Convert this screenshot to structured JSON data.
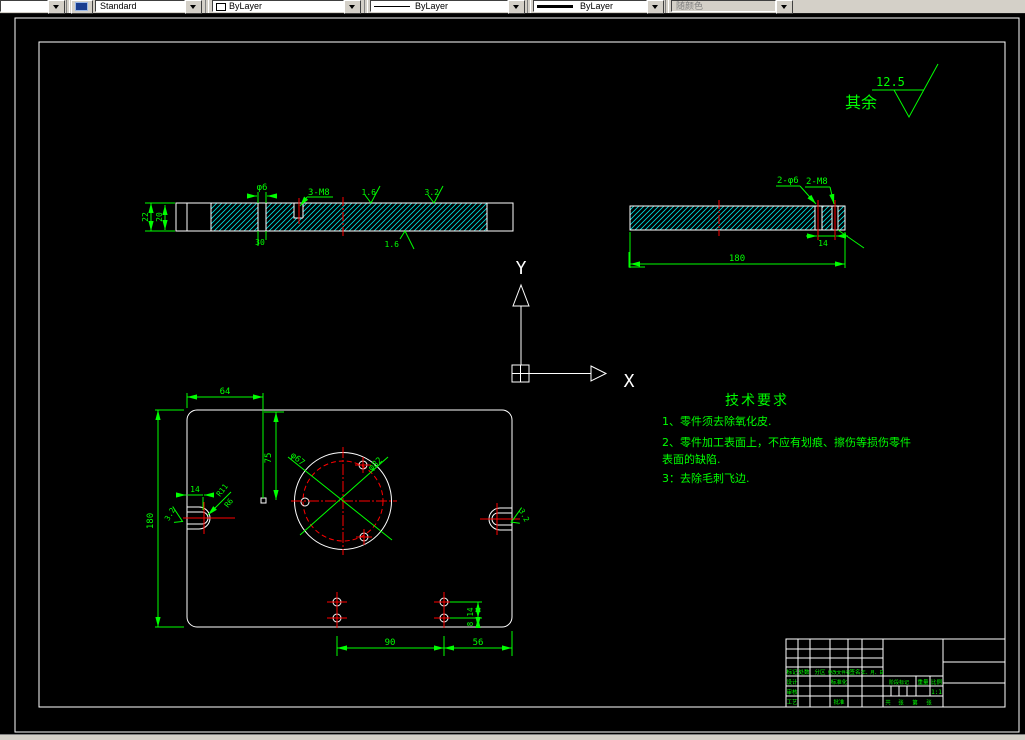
{
  "toolbar": {
    "style_combo": {
      "value": "Standard"
    },
    "color_combo": {
      "value": "ByLayer"
    },
    "linetype_combo": {
      "value": "ByLayer"
    },
    "lineweight_combo": {
      "value": "ByLayer"
    },
    "plotstyle_combo": {
      "value": "随颜色"
    }
  },
  "surface_note": {
    "prefix": "其余",
    "value": "12.5"
  },
  "ucs": {
    "x_label": "X",
    "y_label": "Y"
  },
  "section_left": {
    "dim_height_outer": "22",
    "dim_height_inner": "20",
    "hole_dia": "φ6",
    "hole_note": "30",
    "thread_label": "3-M8",
    "rough_top_1": "1.6",
    "rough_top_2": "3.2",
    "rough_bottom": "1.6"
  },
  "section_right": {
    "holes_label": "2-φ6",
    "thread_label": "2-M8",
    "dim_spacing": "14",
    "dim_length": "180"
  },
  "top_view": {
    "dim_64": "64",
    "dim_75": "75",
    "dim_180": "180",
    "dim_slot": "14",
    "radius_outer": "R11",
    "radius_inner": "R6",
    "rough_left": "3.2",
    "rough_right": "3.2",
    "circle_bolt": "φ67",
    "circle_outer": "φ82",
    "dim_90": "90",
    "dim_56": "56",
    "dim_14": "14",
    "dim_8": "8"
  },
  "tech_req": {
    "title": "技术要求",
    "lines": [
      "1、零件须去除氧化皮.",
      "2、零件加工表面上，不应有划痕、擦伤等损伤零件",
      "表面的缺陷.",
      "3：去除毛刺飞边."
    ]
  },
  "title_block": {
    "mark": "标记",
    "count": "处数",
    "zone": "分区",
    "change_no": "更改文件号",
    "sign": "签名",
    "date": "年、月、日",
    "design": "设计",
    "standardize": "标准化",
    "stage_mark": "阶段标记",
    "weight": "重量",
    "scale": "比例",
    "check": "审核",
    "process": "工艺",
    "approve": "批准",
    "scale_value": "1:1",
    "sheet_total": "共",
    "sheet_unit1": "张",
    "sheet_no": "第",
    "sheet_unit2": "张"
  },
  "colors": {
    "dimension": "#00ff00",
    "centerline": "#ff0000",
    "hatch": "#00e0e0",
    "outline": "#ffffff",
    "background": "#000000",
    "toolbar": "#d4d0c8"
  }
}
